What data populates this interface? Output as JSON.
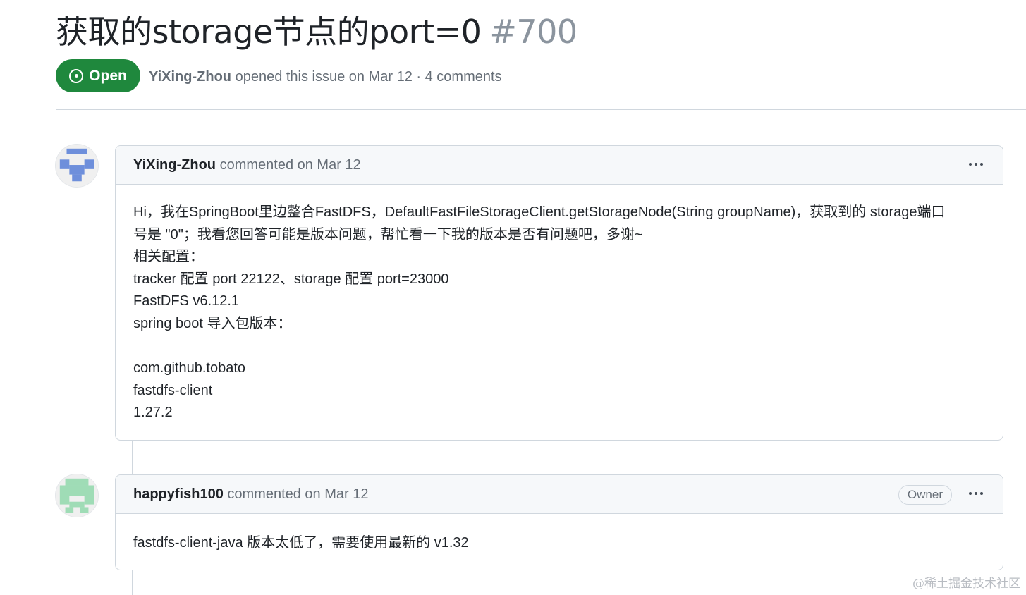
{
  "issue": {
    "title": "获取的storage节点的port=0",
    "number": "#700",
    "state": "Open",
    "meta_author": "YiXing-Zhou",
    "meta_text": " opened this issue on Mar 12 · 4 comments"
  },
  "comments": [
    {
      "author": "YiXing-Zhou",
      "action": " commented on Mar 12",
      "body_lines": [
        "Hi，我在SpringBoot里边整合FastDFS，DefaultFastFileStorageClient.getStorageNode(String groupName)，获取到的 storage端口",
        "号是 \"0\"；我看您回答可能是版本问题，帮忙看一下我的版本是否有问题吧，多谢~",
        "相关配置：",
        "tracker 配置 port 22122、storage 配置 port=23000",
        "FastDFS v6.12.1",
        "spring boot 导入包版本：",
        "",
        "com.github.tobato",
        "fastdfs-client",
        "1.27.2"
      ]
    },
    {
      "author": "happyfish100",
      "action": " commented on Mar 12",
      "role": "Owner",
      "body_lines": [
        "fastdfs-client-java 版本太低了，需要使用最新的 v1.32"
      ]
    }
  ],
  "watermark": "@稀土掘金技术社区",
  "icons": {
    "state": "issue-opened-icon",
    "menu": "kebab-horizontal-icon"
  },
  "colors": {
    "open_green": "#1f883d",
    "muted_text": "#656d76",
    "border": "#d0d7de",
    "header_bg": "#f6f8fa"
  }
}
